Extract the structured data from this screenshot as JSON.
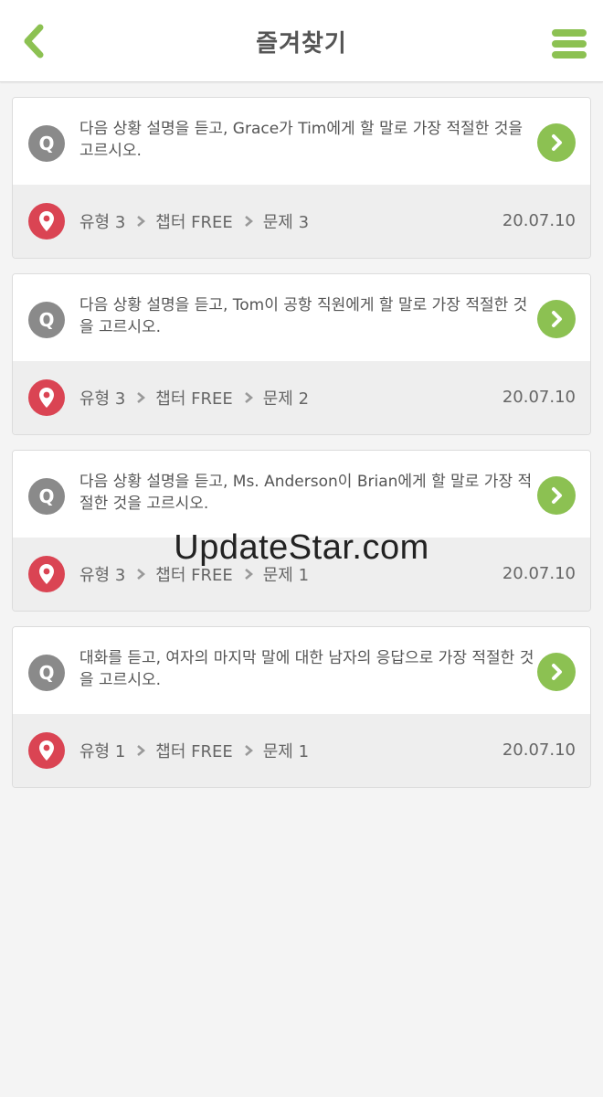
{
  "header": {
    "title": "즐겨찾기",
    "back_icon": "chevron-left-icon",
    "menu_icon": "hamburger-menu-icon",
    "accent_color": "#8cc152"
  },
  "favorites": [
    {
      "question": "다음 상황 설명을 듣고, Grace가 Tim에게 할 말로 가장 적절한 것을 고르시오.",
      "badge": "Q",
      "type": "유형 3",
      "chapter": "챕터 FREE",
      "problem": "문제 3",
      "date": "20.07.10"
    },
    {
      "question": "다음 상황 설명을 듣고, Tom이 공항 직원에게 할 말로 가장 적절한 것을 고르시오.",
      "badge": "Q",
      "type": "유형 3",
      "chapter": "챕터 FREE",
      "problem": "문제 2",
      "date": "20.07.10"
    },
    {
      "question": "다음 상황 설명을 듣고, Ms. Anderson이 Brian에게 할 말로 가장 적절한 것을 고르시오.",
      "badge": "Q",
      "type": "유형 3",
      "chapter": "챕터 FREE",
      "problem": "문제 1",
      "date": "20.07.10"
    },
    {
      "question": "대화를 듣고, 여자의 마지막 말에 대한 남자의 응답으로 가장 적절한 것을 고르시오.",
      "badge": "Q",
      "type": "유형 1",
      "chapter": "챕터 FREE",
      "problem": "문제 1",
      "date": "20.07.10"
    }
  ],
  "watermark": "UpdateStar.com",
  "colors": {
    "go_button": "#8cc152",
    "pin_badge": "#da4453",
    "q_badge": "#8a8a8a"
  }
}
